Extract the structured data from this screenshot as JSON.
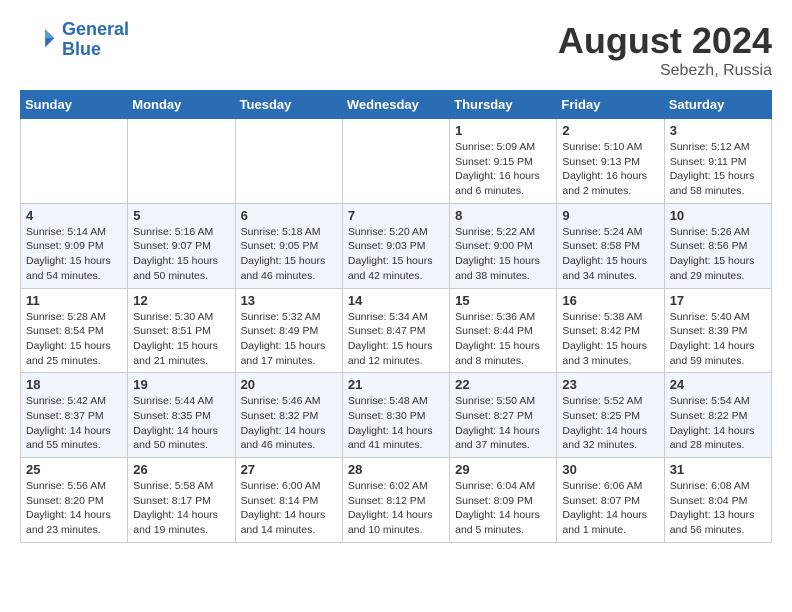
{
  "header": {
    "logo_line1": "General",
    "logo_line2": "Blue",
    "month_year": "August 2024",
    "location": "Sebezh, Russia"
  },
  "days_of_week": [
    "Sunday",
    "Monday",
    "Tuesday",
    "Wednesday",
    "Thursday",
    "Friday",
    "Saturday"
  ],
  "weeks": [
    [
      {
        "day": "",
        "info": ""
      },
      {
        "day": "",
        "info": ""
      },
      {
        "day": "",
        "info": ""
      },
      {
        "day": "",
        "info": ""
      },
      {
        "day": "1",
        "info": "Sunrise: 5:09 AM\nSunset: 9:15 PM\nDaylight: 16 hours\nand 6 minutes."
      },
      {
        "day": "2",
        "info": "Sunrise: 5:10 AM\nSunset: 9:13 PM\nDaylight: 16 hours\nand 2 minutes."
      },
      {
        "day": "3",
        "info": "Sunrise: 5:12 AM\nSunset: 9:11 PM\nDaylight: 15 hours\nand 58 minutes."
      }
    ],
    [
      {
        "day": "4",
        "info": "Sunrise: 5:14 AM\nSunset: 9:09 PM\nDaylight: 15 hours\nand 54 minutes."
      },
      {
        "day": "5",
        "info": "Sunrise: 5:16 AM\nSunset: 9:07 PM\nDaylight: 15 hours\nand 50 minutes."
      },
      {
        "day": "6",
        "info": "Sunrise: 5:18 AM\nSunset: 9:05 PM\nDaylight: 15 hours\nand 46 minutes."
      },
      {
        "day": "7",
        "info": "Sunrise: 5:20 AM\nSunset: 9:03 PM\nDaylight: 15 hours\nand 42 minutes."
      },
      {
        "day": "8",
        "info": "Sunrise: 5:22 AM\nSunset: 9:00 PM\nDaylight: 15 hours\nand 38 minutes."
      },
      {
        "day": "9",
        "info": "Sunrise: 5:24 AM\nSunset: 8:58 PM\nDaylight: 15 hours\nand 34 minutes."
      },
      {
        "day": "10",
        "info": "Sunrise: 5:26 AM\nSunset: 8:56 PM\nDaylight: 15 hours\nand 29 minutes."
      }
    ],
    [
      {
        "day": "11",
        "info": "Sunrise: 5:28 AM\nSunset: 8:54 PM\nDaylight: 15 hours\nand 25 minutes."
      },
      {
        "day": "12",
        "info": "Sunrise: 5:30 AM\nSunset: 8:51 PM\nDaylight: 15 hours\nand 21 minutes."
      },
      {
        "day": "13",
        "info": "Sunrise: 5:32 AM\nSunset: 8:49 PM\nDaylight: 15 hours\nand 17 minutes."
      },
      {
        "day": "14",
        "info": "Sunrise: 5:34 AM\nSunset: 8:47 PM\nDaylight: 15 hours\nand 12 minutes."
      },
      {
        "day": "15",
        "info": "Sunrise: 5:36 AM\nSunset: 8:44 PM\nDaylight: 15 hours\nand 8 minutes."
      },
      {
        "day": "16",
        "info": "Sunrise: 5:38 AM\nSunset: 8:42 PM\nDaylight: 15 hours\nand 3 minutes."
      },
      {
        "day": "17",
        "info": "Sunrise: 5:40 AM\nSunset: 8:39 PM\nDaylight: 14 hours\nand 59 minutes."
      }
    ],
    [
      {
        "day": "18",
        "info": "Sunrise: 5:42 AM\nSunset: 8:37 PM\nDaylight: 14 hours\nand 55 minutes."
      },
      {
        "day": "19",
        "info": "Sunrise: 5:44 AM\nSunset: 8:35 PM\nDaylight: 14 hours\nand 50 minutes."
      },
      {
        "day": "20",
        "info": "Sunrise: 5:46 AM\nSunset: 8:32 PM\nDaylight: 14 hours\nand 46 minutes."
      },
      {
        "day": "21",
        "info": "Sunrise: 5:48 AM\nSunset: 8:30 PM\nDaylight: 14 hours\nand 41 minutes."
      },
      {
        "day": "22",
        "info": "Sunrise: 5:50 AM\nSunset: 8:27 PM\nDaylight: 14 hours\nand 37 minutes."
      },
      {
        "day": "23",
        "info": "Sunrise: 5:52 AM\nSunset: 8:25 PM\nDaylight: 14 hours\nand 32 minutes."
      },
      {
        "day": "24",
        "info": "Sunrise: 5:54 AM\nSunset: 8:22 PM\nDaylight: 14 hours\nand 28 minutes."
      }
    ],
    [
      {
        "day": "25",
        "info": "Sunrise: 5:56 AM\nSunset: 8:20 PM\nDaylight: 14 hours\nand 23 minutes."
      },
      {
        "day": "26",
        "info": "Sunrise: 5:58 AM\nSunset: 8:17 PM\nDaylight: 14 hours\nand 19 minutes."
      },
      {
        "day": "27",
        "info": "Sunrise: 6:00 AM\nSunset: 8:14 PM\nDaylight: 14 hours\nand 14 minutes."
      },
      {
        "day": "28",
        "info": "Sunrise: 6:02 AM\nSunset: 8:12 PM\nDaylight: 14 hours\nand 10 minutes."
      },
      {
        "day": "29",
        "info": "Sunrise: 6:04 AM\nSunset: 8:09 PM\nDaylight: 14 hours\nand 5 minutes."
      },
      {
        "day": "30",
        "info": "Sunrise: 6:06 AM\nSunset: 8:07 PM\nDaylight: 14 hours\nand 1 minute."
      },
      {
        "day": "31",
        "info": "Sunrise: 6:08 AM\nSunset: 8:04 PM\nDaylight: 13 hours\nand 56 minutes."
      }
    ]
  ]
}
